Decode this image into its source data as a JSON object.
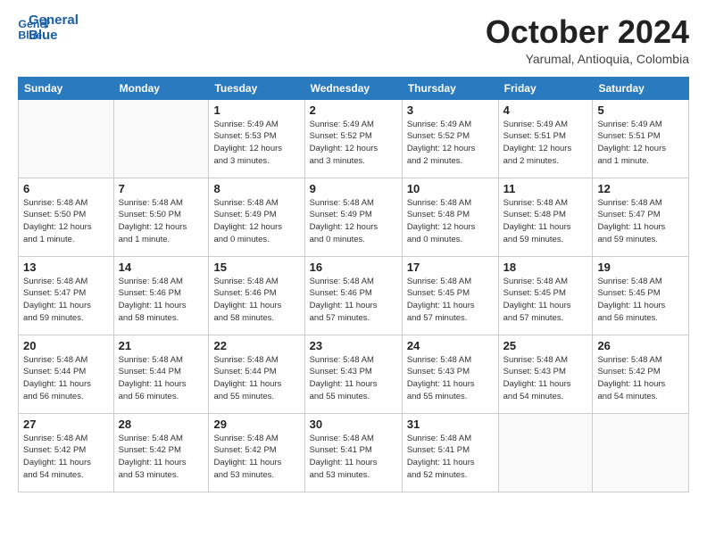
{
  "logo": {
    "line1": "General",
    "line2": "Blue"
  },
  "title": "October 2024",
  "subtitle": "Yarumal, Antioquia, Colombia",
  "weekdays": [
    "Sunday",
    "Monday",
    "Tuesday",
    "Wednesday",
    "Thursday",
    "Friday",
    "Saturday"
  ],
  "weeks": [
    [
      {
        "day": "",
        "info": ""
      },
      {
        "day": "",
        "info": ""
      },
      {
        "day": "1",
        "info": "Sunrise: 5:49 AM\nSunset: 5:53 PM\nDaylight: 12 hours\nand 3 minutes."
      },
      {
        "day": "2",
        "info": "Sunrise: 5:49 AM\nSunset: 5:52 PM\nDaylight: 12 hours\nand 3 minutes."
      },
      {
        "day": "3",
        "info": "Sunrise: 5:49 AM\nSunset: 5:52 PM\nDaylight: 12 hours\nand 2 minutes."
      },
      {
        "day": "4",
        "info": "Sunrise: 5:49 AM\nSunset: 5:51 PM\nDaylight: 12 hours\nand 2 minutes."
      },
      {
        "day": "5",
        "info": "Sunrise: 5:49 AM\nSunset: 5:51 PM\nDaylight: 12 hours\nand 1 minute."
      }
    ],
    [
      {
        "day": "6",
        "info": "Sunrise: 5:48 AM\nSunset: 5:50 PM\nDaylight: 12 hours\nand 1 minute."
      },
      {
        "day": "7",
        "info": "Sunrise: 5:48 AM\nSunset: 5:50 PM\nDaylight: 12 hours\nand 1 minute."
      },
      {
        "day": "8",
        "info": "Sunrise: 5:48 AM\nSunset: 5:49 PM\nDaylight: 12 hours\nand 0 minutes."
      },
      {
        "day": "9",
        "info": "Sunrise: 5:48 AM\nSunset: 5:49 PM\nDaylight: 12 hours\nand 0 minutes."
      },
      {
        "day": "10",
        "info": "Sunrise: 5:48 AM\nSunset: 5:48 PM\nDaylight: 12 hours\nand 0 minutes."
      },
      {
        "day": "11",
        "info": "Sunrise: 5:48 AM\nSunset: 5:48 PM\nDaylight: 11 hours\nand 59 minutes."
      },
      {
        "day": "12",
        "info": "Sunrise: 5:48 AM\nSunset: 5:47 PM\nDaylight: 11 hours\nand 59 minutes."
      }
    ],
    [
      {
        "day": "13",
        "info": "Sunrise: 5:48 AM\nSunset: 5:47 PM\nDaylight: 11 hours\nand 59 minutes."
      },
      {
        "day": "14",
        "info": "Sunrise: 5:48 AM\nSunset: 5:46 PM\nDaylight: 11 hours\nand 58 minutes."
      },
      {
        "day": "15",
        "info": "Sunrise: 5:48 AM\nSunset: 5:46 PM\nDaylight: 11 hours\nand 58 minutes."
      },
      {
        "day": "16",
        "info": "Sunrise: 5:48 AM\nSunset: 5:46 PM\nDaylight: 11 hours\nand 57 minutes."
      },
      {
        "day": "17",
        "info": "Sunrise: 5:48 AM\nSunset: 5:45 PM\nDaylight: 11 hours\nand 57 minutes."
      },
      {
        "day": "18",
        "info": "Sunrise: 5:48 AM\nSunset: 5:45 PM\nDaylight: 11 hours\nand 57 minutes."
      },
      {
        "day": "19",
        "info": "Sunrise: 5:48 AM\nSunset: 5:45 PM\nDaylight: 11 hours\nand 56 minutes."
      }
    ],
    [
      {
        "day": "20",
        "info": "Sunrise: 5:48 AM\nSunset: 5:44 PM\nDaylight: 11 hours\nand 56 minutes."
      },
      {
        "day": "21",
        "info": "Sunrise: 5:48 AM\nSunset: 5:44 PM\nDaylight: 11 hours\nand 56 minutes."
      },
      {
        "day": "22",
        "info": "Sunrise: 5:48 AM\nSunset: 5:44 PM\nDaylight: 11 hours\nand 55 minutes."
      },
      {
        "day": "23",
        "info": "Sunrise: 5:48 AM\nSunset: 5:43 PM\nDaylight: 11 hours\nand 55 minutes."
      },
      {
        "day": "24",
        "info": "Sunrise: 5:48 AM\nSunset: 5:43 PM\nDaylight: 11 hours\nand 55 minutes."
      },
      {
        "day": "25",
        "info": "Sunrise: 5:48 AM\nSunset: 5:43 PM\nDaylight: 11 hours\nand 54 minutes."
      },
      {
        "day": "26",
        "info": "Sunrise: 5:48 AM\nSunset: 5:42 PM\nDaylight: 11 hours\nand 54 minutes."
      }
    ],
    [
      {
        "day": "27",
        "info": "Sunrise: 5:48 AM\nSunset: 5:42 PM\nDaylight: 11 hours\nand 54 minutes."
      },
      {
        "day": "28",
        "info": "Sunrise: 5:48 AM\nSunset: 5:42 PM\nDaylight: 11 hours\nand 53 minutes."
      },
      {
        "day": "29",
        "info": "Sunrise: 5:48 AM\nSunset: 5:42 PM\nDaylight: 11 hours\nand 53 minutes."
      },
      {
        "day": "30",
        "info": "Sunrise: 5:48 AM\nSunset: 5:41 PM\nDaylight: 11 hours\nand 53 minutes."
      },
      {
        "day": "31",
        "info": "Sunrise: 5:48 AM\nSunset: 5:41 PM\nDaylight: 11 hours\nand 52 minutes."
      },
      {
        "day": "",
        "info": ""
      },
      {
        "day": "",
        "info": ""
      }
    ]
  ]
}
